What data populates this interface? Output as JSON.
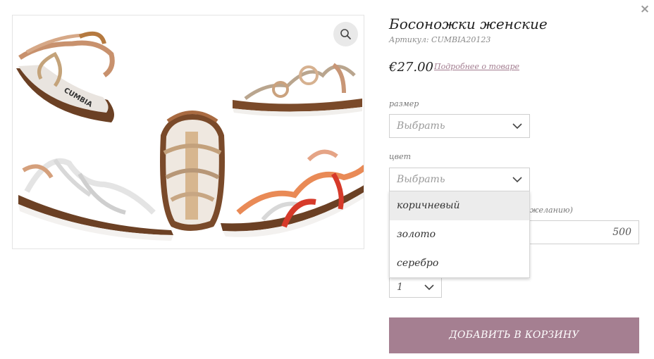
{
  "product": {
    "title": "Босоножки женские",
    "sku": "Артикул: CUMBIA20123",
    "price": "€27.00",
    "details_link": "Подробнее о товаре",
    "image_brand_text": "CUMBIA"
  },
  "fields": {
    "size": {
      "label": "размер",
      "value": "Выбрать"
    },
    "color": {
      "label": "цвет",
      "value": "Выбрать",
      "options": [
        "коричневый",
        "золото",
        "серебро"
      ],
      "highlighted_option": "коричневый"
    },
    "custom_amount": {
      "label_partial": "желанию)",
      "value": "500"
    },
    "quantity": {
      "value": "1"
    }
  },
  "buttons": {
    "add_to_cart": "ДОБАВИТЬ В КОРЗИНУ",
    "close": "×"
  },
  "colors": {
    "accent": "#a57f91",
    "link": "#a27c8f",
    "border": "#cfcfcf"
  }
}
